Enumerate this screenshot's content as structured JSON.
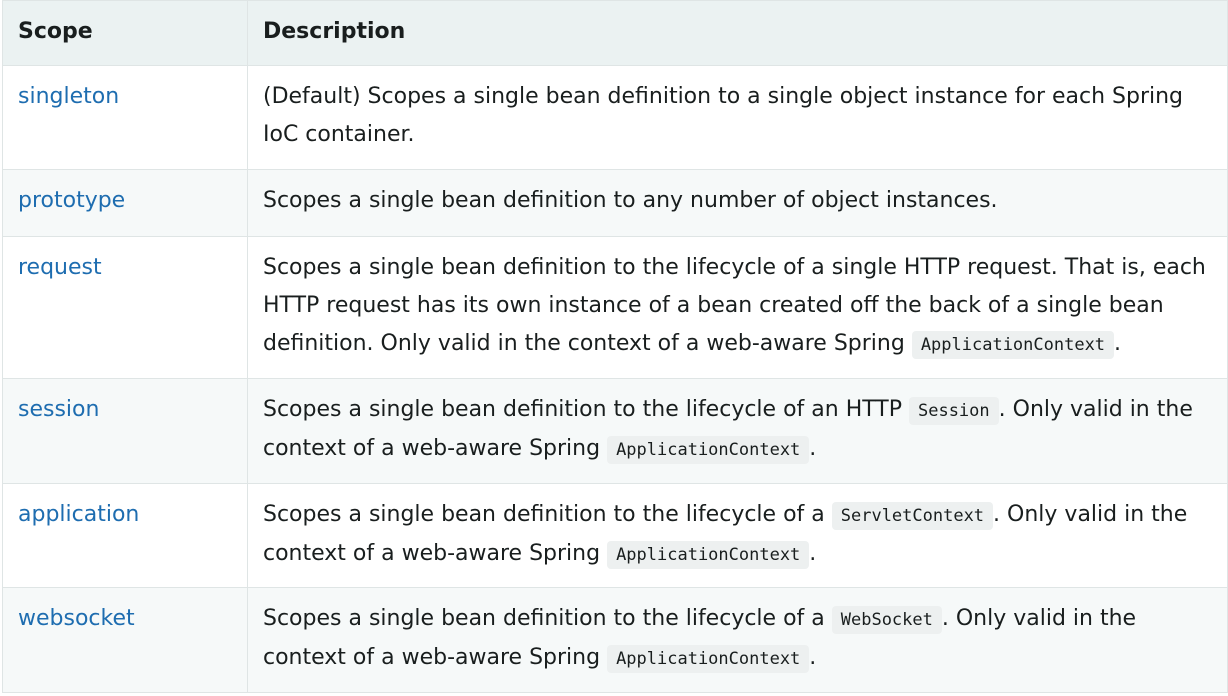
{
  "headers": {
    "scope": "Scope",
    "description": "Description"
  },
  "rows": [
    {
      "scope": "singleton",
      "parts": [
        "(Default) Scopes a single bean definition to a single object instance for each Spring IoC container."
      ],
      "codes": []
    },
    {
      "scope": "prototype",
      "parts": [
        "Scopes a single bean definition to any number of object instances."
      ],
      "codes": []
    },
    {
      "scope": "request",
      "parts": [
        "Scopes a single bean definition to the lifecycle of a single HTTP request. That is, each HTTP request has its own instance of a bean created off the back of a single bean definition. Only valid in the context of a web-aware Spring ",
        "."
      ],
      "codes": [
        "ApplicationContext"
      ]
    },
    {
      "scope": "session",
      "parts": [
        "Scopes a single bean definition to the lifecycle of an HTTP ",
        ". Only valid in the context of a web-aware Spring ",
        "."
      ],
      "codes": [
        "Session",
        "ApplicationContext"
      ]
    },
    {
      "scope": "application",
      "parts": [
        "Scopes a single bean definition to the lifecycle of a ",
        ". Only valid in the context of a web-aware Spring ",
        "."
      ],
      "codes": [
        "ServletContext",
        "ApplicationContext"
      ]
    },
    {
      "scope": "websocket",
      "parts": [
        "Scopes a single bean definition to the lifecycle of a ",
        ". Only valid in the context of a web-aware Spring ",
        "."
      ],
      "codes": [
        "WebSocket",
        "ApplicationContext"
      ]
    }
  ]
}
